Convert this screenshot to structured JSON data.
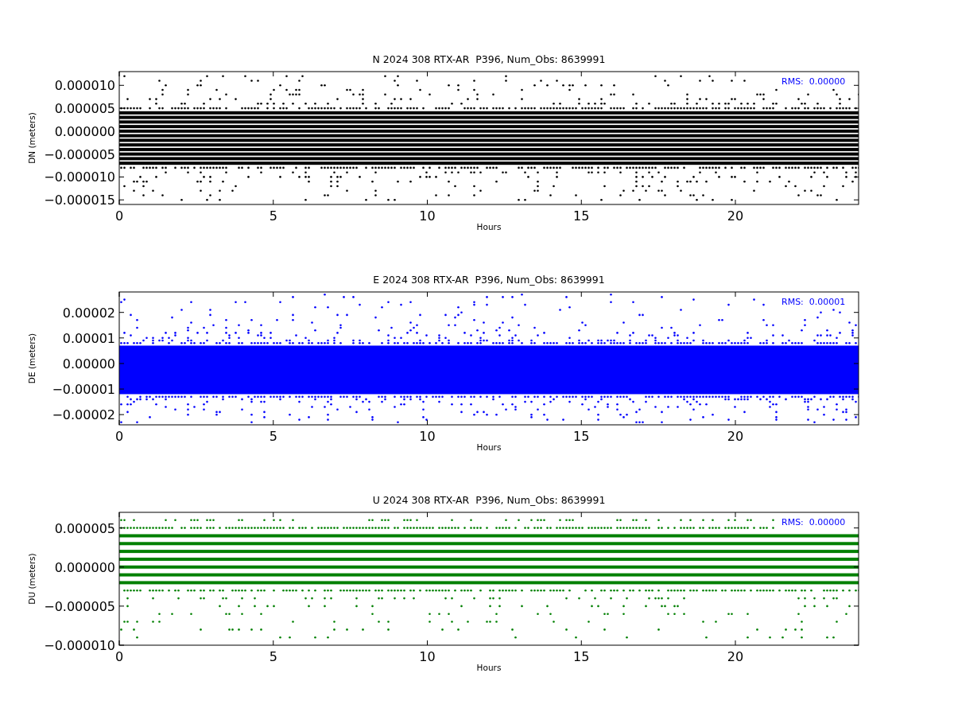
{
  "panels": [
    {
      "kind": "scatter",
      "title": "N 2024 308 RTX-AR  P396, Num_Obs: 8639991",
      "xlabel": "Hours",
      "ylabel": "DN (meters)",
      "color": "#000000",
      "x_tick_labels": [
        "0",
        "5",
        "10",
        "15",
        "20"
      ],
      "y_tick_labels": [
        "0.000010",
        "0.000005",
        "0.000000",
        "−0.000005",
        "−0.000010",
        "−0.000015"
      ],
      "annotation": "RMS:  0.00000"
    },
    {
      "kind": "scatter",
      "title": "E 2024 308 RTX-AR  P396, Num_Obs: 8639991",
      "xlabel": "Hours",
      "ylabel": "DE (meters)",
      "color": "#0000ff",
      "x_tick_labels": [
        "0",
        "5",
        "10",
        "15",
        "20"
      ],
      "y_tick_labels": [
        "0.00002",
        "0.00001",
        "0.00000",
        "−0.00001",
        "−0.00002"
      ],
      "annotation": "RMS:  0.00001"
    },
    {
      "kind": "scatter",
      "title": "U 2024 308 RTX-AR  P396, Num_Obs: 8639991",
      "xlabel": "Hours",
      "ylabel": "DU (meters)",
      "color": "#008000",
      "x_tick_labels": [
        "0",
        "5",
        "10",
        "15",
        "20"
      ],
      "y_tick_labels": [
        "0.000005",
        "0.000000",
        "−0.000005",
        "−0.000010"
      ],
      "annotation": "RMS:  0.00000"
    }
  ]
}
